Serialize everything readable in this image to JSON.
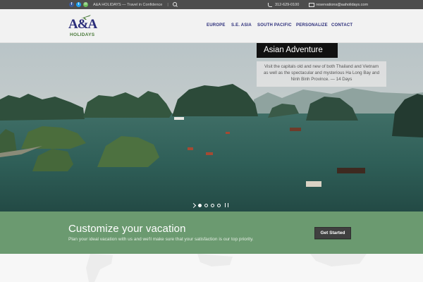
{
  "topbar": {
    "social": [
      {
        "icon": "facebook-icon",
        "glyph": "f"
      },
      {
        "icon": "twitter-icon",
        "glyph": "t"
      },
      {
        "icon": "email-icon",
        "glyph": "✉"
      }
    ],
    "tagline": "A&A HOLIDAYS — Travel in Confidence",
    "separator": "|",
    "phone": "312-629-0100",
    "email": "reservations@aaholidays.com"
  },
  "header": {
    "logo": {
      "letters": "A&A",
      "word": "HOLIDAYS"
    },
    "nav": [
      "EUROPE",
      "S.E. ASIA",
      "SOUTH PACIFIC",
      "PERSONALIZE",
      "CONTACT"
    ]
  },
  "hero": {
    "caption_title": "Asian Adventure",
    "caption_body": "Visit the capitals old and new of both Thailand and Vietnam as well as the spectacular and mysterious Ha Long Bay and Ninh Binh Province. — 14 Days",
    "slides": 4,
    "active_slide": 1
  },
  "cta": {
    "title": "Customize your vacation",
    "subtitle": "Plan your ideal vacation with us and we'll make sure that your satisfaction is our top priority.",
    "button": "Get Started"
  },
  "colors": {
    "topbar": "#4d4d4d",
    "nav": "#2b2d7a",
    "cta_band": "#6b9a70",
    "button": "#404040"
  }
}
